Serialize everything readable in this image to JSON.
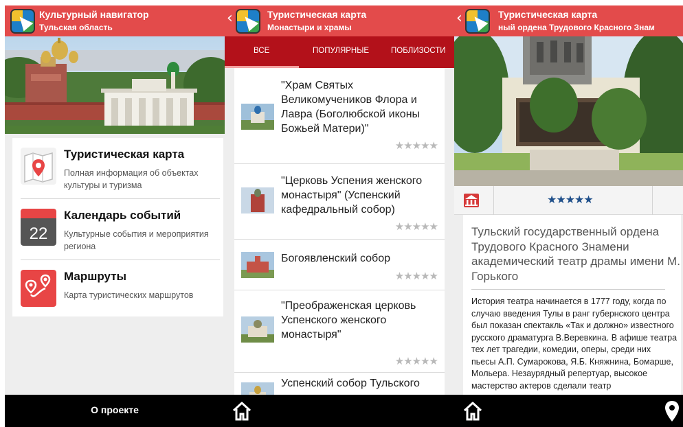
{
  "screen1": {
    "app_title": "Культурный навигатор",
    "region": "Тульская область",
    "menu": [
      {
        "title": "Туристическая карта",
        "description": "Полная информация об объектах культуры и туризма",
        "icon": "map-pin-icon"
      },
      {
        "title": "Календарь событий",
        "description": "Культурные события и мероприятия региона",
        "icon": "calendar-icon",
        "day": "22"
      },
      {
        "title": "Маршруты",
        "description": "Карта туристических маршрутов",
        "icon": "route-icon"
      }
    ],
    "about_label": "О проекте"
  },
  "screen2": {
    "title": "Туристическая карта",
    "subtitle": "Монастыри и храмы",
    "tabs": [
      "ВСЕ",
      "ПОПУЛЯРНЫЕ",
      "ПОБЛИЗОСТИ"
    ],
    "active_tab": "ВСЕ",
    "items": [
      {
        "name": "\"Храм Святых Великомучеников Флора и Лавра (Боголюбской иконы Божьей Матери)\"",
        "rating": 0
      },
      {
        "name": "\"Церковь Успения женского монастыря\" (Успенский кафедральный собор)",
        "rating": 0
      },
      {
        "name": "Богоявленский собор",
        "rating": 0
      },
      {
        "name": "\"Преображенская церковь Успенского женского монастыря\"",
        "rating": 0
      },
      {
        "name": "Успенский собор Тульского кремля",
        "rating": 0
      }
    ],
    "stars": "★★★★★"
  },
  "screen3": {
    "title": "Туристическая карта",
    "subtitle": "ный ордена Трудового Красного Знам",
    "stars": "★★★★★",
    "rating": 5,
    "place_title": "Тульский государственный ордена Трудового Красного Знамени академический театр драмы имени М. Горького",
    "description": "История театра начинается в 1777 году, когда по случаю введения Тулы в ранг губернского центра был показан спектакль «Так и должно» известного русского драматурга В.Веревкина. В афише театра тех лет трагедии, комедии, оперы, среди них пьесы А.П. Сумарокова, Я.Б. Княжнина, Бомарше, Мольера. Незаурядный репертуар, высокое мастерство актеров сделали театр"
  },
  "colors": {
    "header_red": "#e34b4b",
    "tab_dark_red": "#b3111a",
    "bottom_bar": "#000000",
    "rating_blue": "#1f4f8a"
  }
}
